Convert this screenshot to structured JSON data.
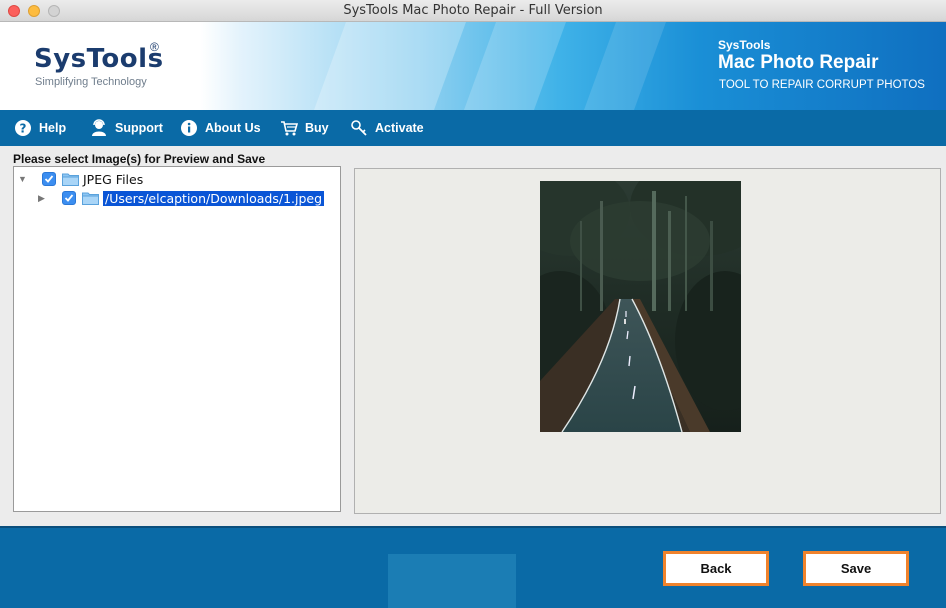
{
  "window": {
    "title": "SysTools Mac Photo Repair - Full Version"
  },
  "banner": {
    "logo_name": "SysTools",
    "logo_mark": "®",
    "logo_tagline": "Simplifying Technology",
    "product_brand": "SysTools",
    "product_name": "Mac Photo Repair",
    "product_subtitle": "TOOL TO REPAIR CORRUPT PHOTOS"
  },
  "menu": {
    "items": [
      {
        "label": "Help",
        "icon": "help-icon"
      },
      {
        "label": "Support",
        "icon": "support-icon"
      },
      {
        "label": "About Us",
        "icon": "info-icon"
      },
      {
        "label": "Buy",
        "icon": "cart-icon"
      },
      {
        "label": "Activate",
        "icon": "key-icon"
      }
    ]
  },
  "main": {
    "panel_label": "Please select Image(s) for Preview and Save",
    "tree": {
      "root": {
        "label": "JPEG Files",
        "checked": true,
        "expanded": true
      },
      "children": [
        {
          "label": "/Users/elcaption/Downloads/1.jpeg",
          "checked": true,
          "selected": true
        }
      ]
    },
    "preview": {
      "image_description": "forest-road-photo"
    }
  },
  "footer": {
    "back_label": "Back",
    "save_label": "Save"
  },
  "colors": {
    "menu_bar": "#0a6aa6",
    "button_border": "#f0832c",
    "selection": "#0a55d6"
  }
}
